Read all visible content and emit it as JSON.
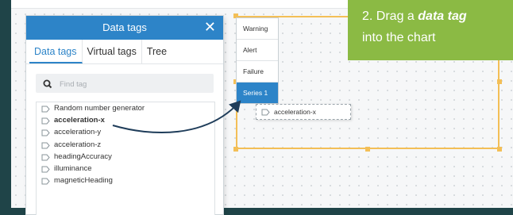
{
  "panel": {
    "title": "Data tags",
    "close_glyph": "✕",
    "tabs": [
      {
        "label": "Data tags",
        "active": true
      },
      {
        "label": "Virtual tags",
        "active": false
      },
      {
        "label": "Tree",
        "active": false
      }
    ],
    "search": {
      "placeholder": "Find tag",
      "value": "",
      "icon": "search-icon"
    },
    "tags": [
      "Random number generator",
      "acceleration-x",
      "acceleration-y",
      "acceleration-z",
      "headingAccuracy",
      "illuminance",
      "magneticHeading"
    ],
    "highlighted_tag": "acceleration-x"
  },
  "chart": {
    "legend": [
      {
        "label": "Warning",
        "active": false
      },
      {
        "label": "Alert",
        "active": false
      },
      {
        "label": "Failure",
        "active": false
      },
      {
        "label": "Series 1",
        "active": true
      }
    ],
    "drag_chip_label": "acceleration-x"
  },
  "callout": {
    "prefix": "2. Drag a ",
    "emphasis": "data tag",
    "line2": "into the chart"
  },
  "colors": {
    "accent": "#2d84c8",
    "callout": "#8bba44",
    "selection": "#f3bf57",
    "background": "#1f4448"
  }
}
